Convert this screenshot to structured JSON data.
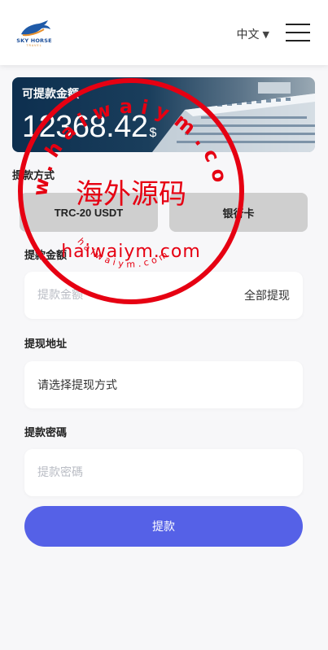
{
  "header": {
    "logo_text": "SKY HORSE",
    "logo_sub": "TRAVEL",
    "language": "中文",
    "menu_icon": "hamburger-menu-icon"
  },
  "balance": {
    "label": "可提款金额",
    "amount": "12368.42",
    "unit": "$"
  },
  "method": {
    "title": "提款方式",
    "options": [
      "TRC-20 USDT",
      "银行卡"
    ]
  },
  "amount_field": {
    "title": "提款金额",
    "placeholder": "提款金额",
    "all_label": "全部提现"
  },
  "address_field": {
    "title": "提现地址",
    "value": "请选择提现方式"
  },
  "password_field": {
    "title": "提款密碼",
    "placeholder": "提款密碼"
  },
  "submit_label": "提款",
  "watermark": {
    "top_arc": "w.haiwaiym.com",
    "center": "海外源码",
    "middle": "haiwaiym.com",
    "bottom_arc": "haiwaiym.com"
  },
  "colors": {
    "primary": "#5561e7",
    "stamp": "#e60012",
    "method_button": "#cfcfcf"
  }
}
